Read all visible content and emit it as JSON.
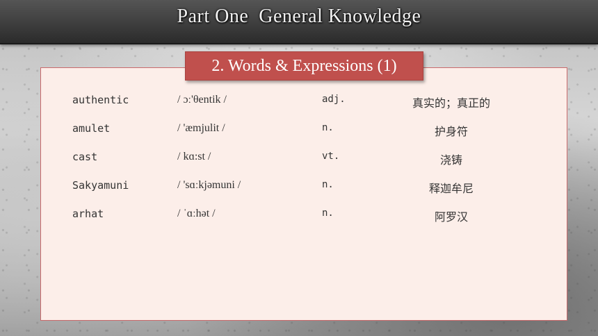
{
  "header": {
    "title": "Part One  General Knowledge"
  },
  "section": {
    "title": "2. Words & Expressions (1)"
  },
  "vocab": [
    {
      "word": "authentic",
      "phonetic": "/ ɔː'θentik /",
      "pos": "adj.",
      "meaning": "真实的；真正的"
    },
    {
      "word": "amulet",
      "phonetic": "/ 'æmjulit /",
      "pos": "n.",
      "meaning": "护身符"
    },
    {
      "word": "cast",
      "phonetic": "/ kɑ:st /",
      "pos": "vt.",
      "meaning": "浇铸"
    },
    {
      "word": "Sakyamuni",
      "phonetic": "/ 'sɑːkjəmuni /",
      "pos": "n.",
      "meaning": "释迦牟尼"
    },
    {
      "word": "arhat",
      "phonetic": "/ ˈɑːhət /",
      "pos": "n.",
      "meaning": "阿罗汉"
    }
  ],
  "colors": {
    "banner": "#c0504d",
    "panel": "#fceee9",
    "panel_border": "#c9696b"
  }
}
